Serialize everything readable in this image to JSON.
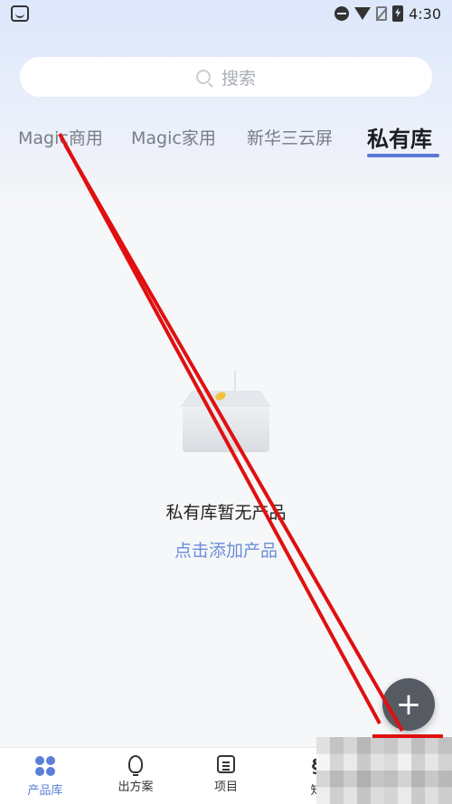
{
  "status_bar": {
    "time": "4:30"
  },
  "search": {
    "placeholder": "搜索"
  },
  "tabs": [
    {
      "label": "Magic商用"
    },
    {
      "label": "Magic家用"
    },
    {
      "label": "新华三云屏"
    },
    {
      "label": "私有库",
      "active": true
    }
  ],
  "empty_state": {
    "title": "私有库暂无产品",
    "action_link": "点击添加产品"
  },
  "fab": {
    "label": "+"
  },
  "bottom_nav": [
    {
      "label": "产品库",
      "icon": "grid-icon",
      "active": true
    },
    {
      "label": "出方案",
      "icon": "lightbulb-icon"
    },
    {
      "label": "项目",
      "icon": "list-icon"
    },
    {
      "label": "知",
      "icon": "knowledge-icon"
    }
  ],
  "colors": {
    "accent": "#5b7fd8",
    "link": "#6a8ed9",
    "fab": "#555a63",
    "annotation": "#e01010"
  }
}
